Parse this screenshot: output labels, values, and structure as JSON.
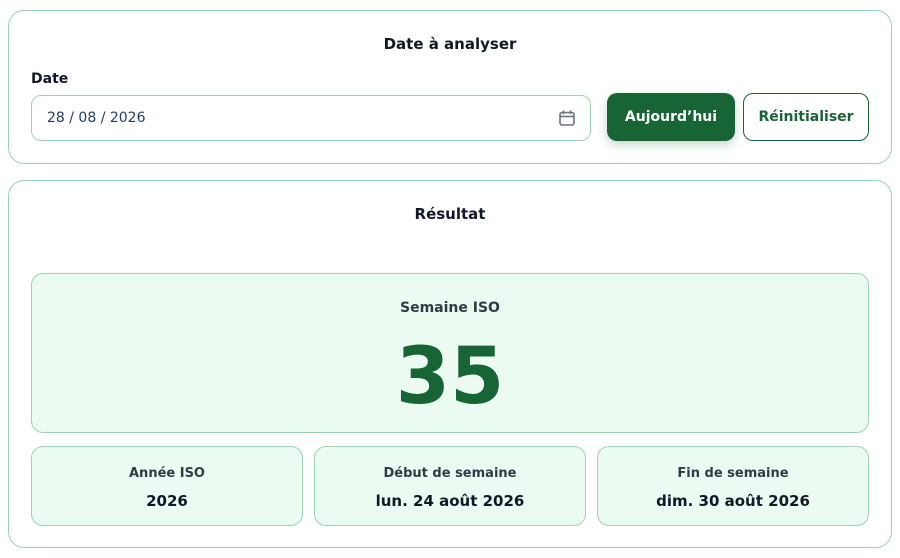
{
  "input_section": {
    "title": "Date à analyser",
    "field_label": "Date",
    "date_value": "28 / 08 / 2026",
    "icons": {
      "calendar": "calendar-icon"
    },
    "today_button_label": "Aujourd’hui",
    "reset_button_label": "Réinitialiser"
  },
  "result_section": {
    "title": "Résultat",
    "week_label": "Semaine ISO",
    "week_number": "35",
    "iso_year_label": "Année ISO",
    "iso_year_value": "2026",
    "week_start_label": "Début de semaine",
    "week_start_value": "lun. 24 août 2026",
    "week_end_label": "Fin de semaine",
    "week_end_value": "dim. 30 août 2026"
  },
  "colors": {
    "primary": "#176534",
    "panel_background": "#ecfbf1",
    "border": "#9fd1b4"
  }
}
